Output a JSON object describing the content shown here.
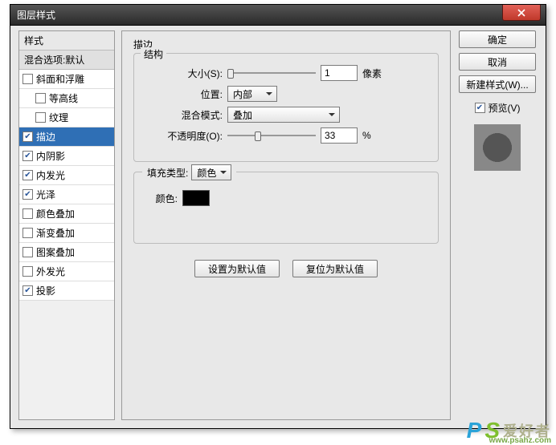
{
  "window": {
    "title": "图层样式"
  },
  "left": {
    "header": "样式",
    "blend": "混合选项:默认",
    "items": [
      {
        "label": "斜面和浮雕",
        "checked": false,
        "indent": false
      },
      {
        "label": "等高线",
        "checked": false,
        "indent": true
      },
      {
        "label": "纹理",
        "checked": false,
        "indent": true
      },
      {
        "label": "描边",
        "checked": true,
        "indent": false,
        "selected": true
      },
      {
        "label": "内阴影",
        "checked": true,
        "indent": false
      },
      {
        "label": "内发光",
        "checked": true,
        "indent": false
      },
      {
        "label": "光泽",
        "checked": true,
        "indent": false
      },
      {
        "label": "颜色叠加",
        "checked": false,
        "indent": false
      },
      {
        "label": "渐变叠加",
        "checked": false,
        "indent": false
      },
      {
        "label": "图案叠加",
        "checked": false,
        "indent": false
      },
      {
        "label": "外发光",
        "checked": false,
        "indent": false
      },
      {
        "label": "投影",
        "checked": true,
        "indent": false
      }
    ]
  },
  "center": {
    "title": "描边",
    "structure_legend": "结构",
    "size_label": "大小(S):",
    "size_value": "1",
    "size_unit": "像素",
    "position_label": "位置:",
    "position_value": "内部",
    "blendmode_label": "混合模式:",
    "blendmode_value": "叠加",
    "opacity_label": "不透明度(O):",
    "opacity_value": "33",
    "opacity_unit": "%",
    "filltype_label": "填充类型:",
    "filltype_value": "颜色",
    "color_label": "颜色:",
    "color_value": "#000000",
    "btn_default": "设置为默认值",
    "btn_reset": "复位为默认值"
  },
  "right": {
    "ok": "确定",
    "cancel": "取消",
    "newstyle": "新建样式(W)...",
    "preview": "预览(V)"
  },
  "watermark": {
    "txt": "爱好者",
    "url": "www.psahz.com"
  }
}
